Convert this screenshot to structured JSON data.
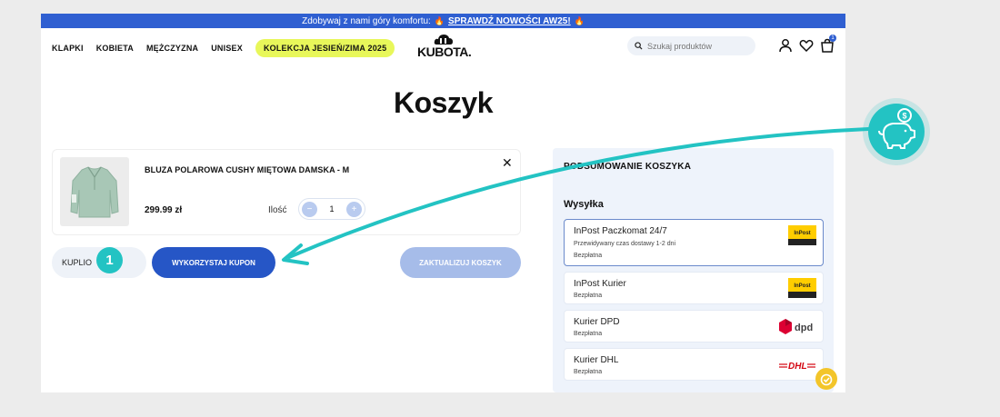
{
  "promo_bar": {
    "text": "Zdobywaj z nami góry komfortu:",
    "link": "SPRAWDŹ NOWOŚCI AW25!",
    "flame_icon": "🔥"
  },
  "nav": {
    "items": [
      "KLAPKI",
      "KOBIETA",
      "MĘŻCZYZNA",
      "UNISEX"
    ],
    "collection": "KOLEKCJA JESIEŃ/ZIMA 2025"
  },
  "logo": {
    "text": "KUBOTA",
    "dot": "."
  },
  "search": {
    "placeholder": "Szukaj produktów"
  },
  "header_icons": {
    "cart_count": "1",
    "user_icon": "user-icon",
    "heart_icon": "heart-icon",
    "bag_icon": "shopping-bag-icon"
  },
  "page": {
    "title": "Koszyk"
  },
  "cart": {
    "item": {
      "name": "BLUZA POLAROWA CUSHY MIĘTOWA DAMSKA - M",
      "price": "299.99 zł",
      "qty_label": "Ilość",
      "qty_value": "1",
      "minus": "−",
      "plus": "+",
      "remove": "✕"
    },
    "coupon_label": "KUPLIO",
    "apply_coupon": "WYKORZYSTAJ KUPON",
    "update_cart": "ZAKTUALIZUJ KOSZYK",
    "step_number": "1"
  },
  "summary": {
    "title": "PODSUMOWANIE KOSZYKA",
    "shipping_label": "Wysyłka",
    "options": [
      {
        "name": "InPost Paczkomat 24/7",
        "eta": "Przewidywany czas dostawy 1-2 dni",
        "price": "Bezpłatna",
        "logo": "inpost-paczkomat",
        "logo_text": "InPost"
      },
      {
        "name": "InPost Kurier",
        "eta": "",
        "price": "Bezpłatna",
        "logo": "inpost-kurier",
        "logo_text": "InPost"
      },
      {
        "name": "Kurier DPD",
        "eta": "",
        "price": "Bezpłatna",
        "logo": "dpd",
        "logo_text": "dpd"
      },
      {
        "name": "Kurier DHL",
        "eta": "",
        "price": "Bezpłatna",
        "logo": "dhl",
        "logo_text": "DHL"
      }
    ]
  },
  "colors": {
    "brand_blue": "#2656c6",
    "promo_blue": "#2f5fd1",
    "teal": "#23c3c3",
    "collection_yellow": "#e8f75a",
    "summary_bg": "#eef3fb"
  }
}
